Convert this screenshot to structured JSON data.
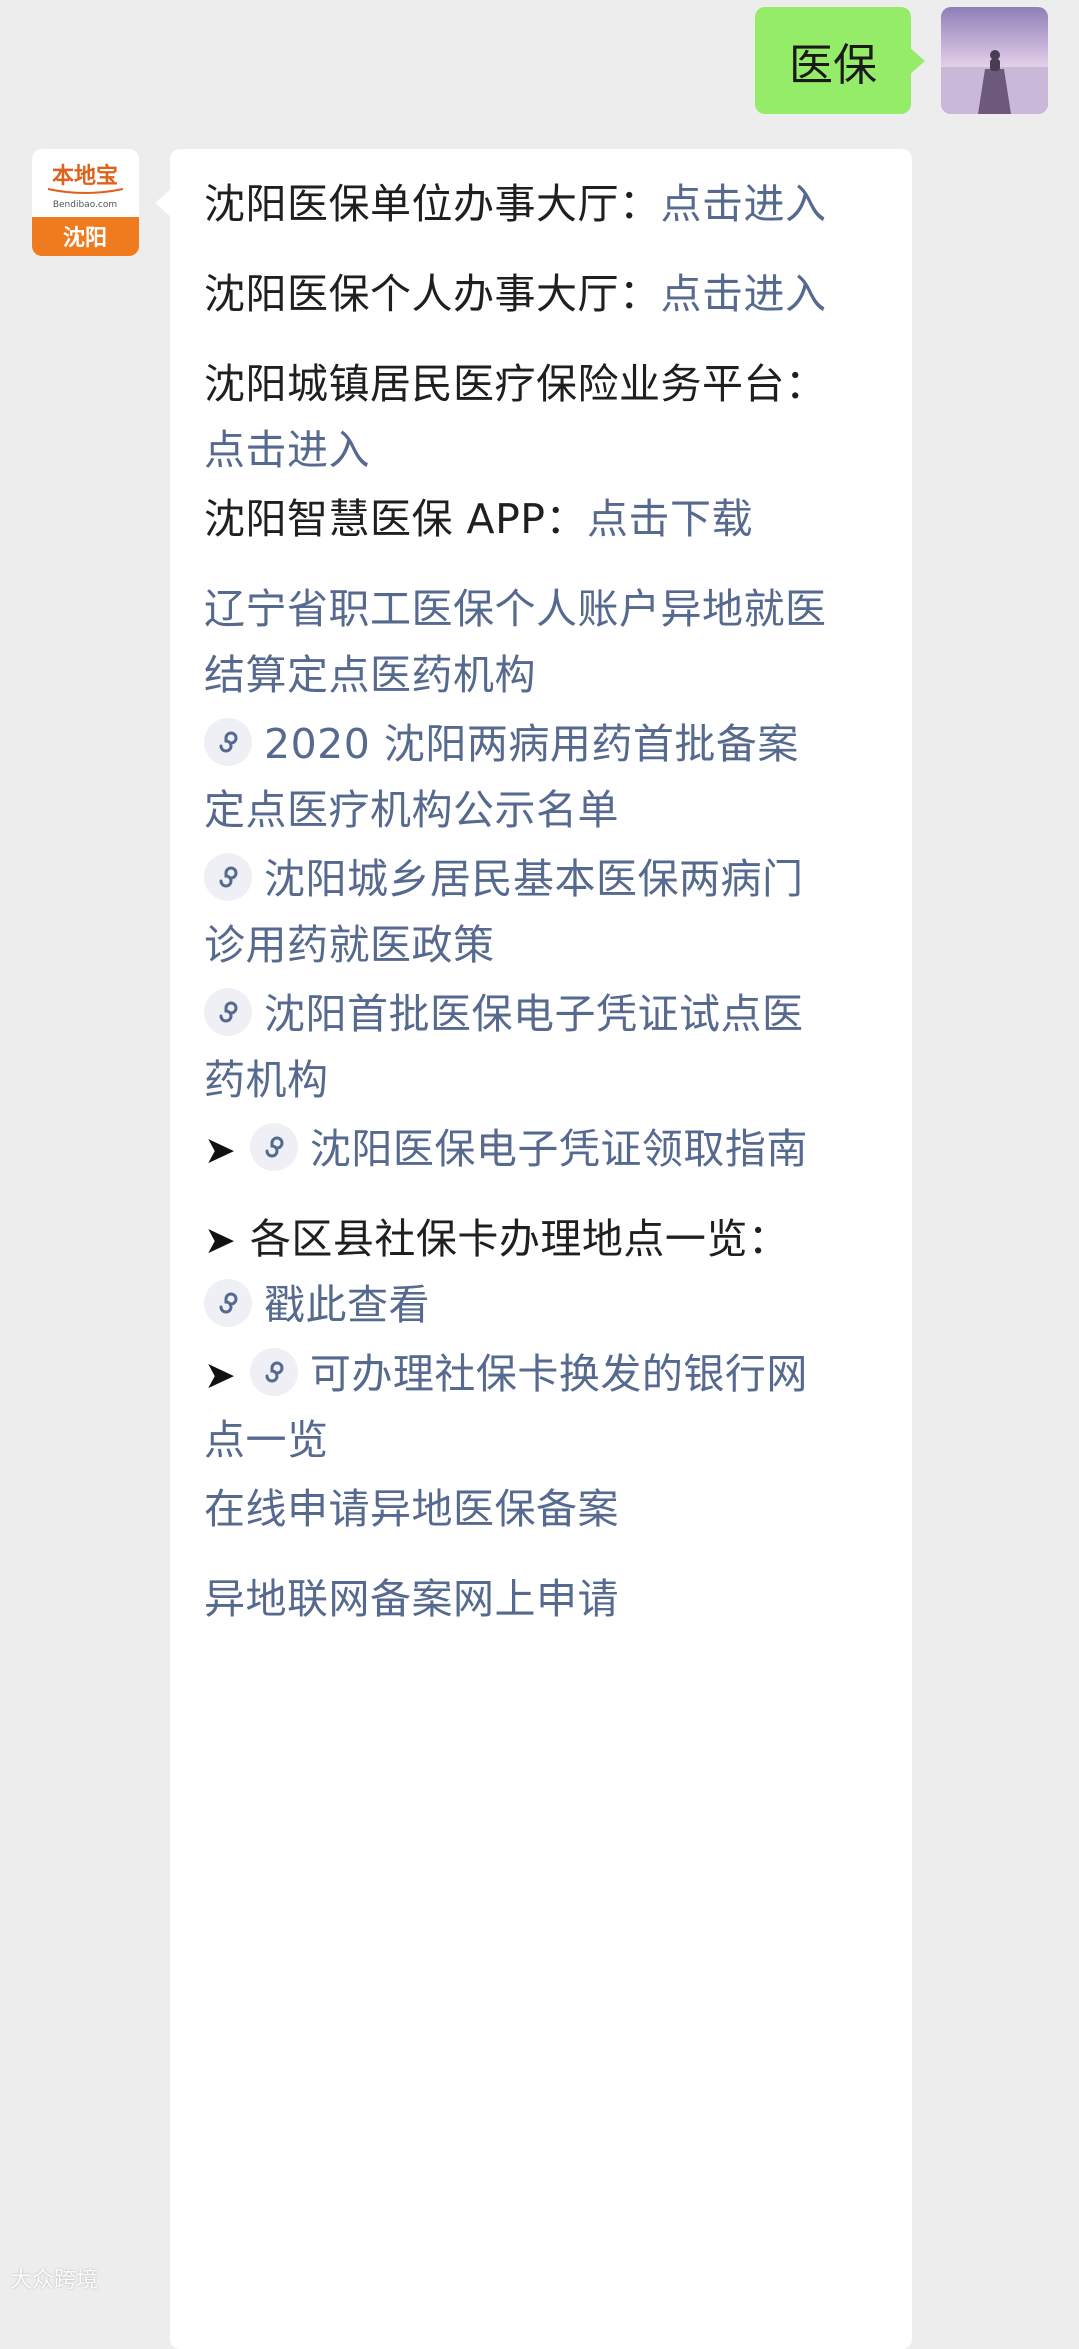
{
  "user_message": {
    "text": "医保"
  },
  "bot_avatar": {
    "brand": "本地宝",
    "domain": "Bendibao.com",
    "city": "沈阳"
  },
  "reply": {
    "l1_title": "沈阳医保单位办事大厅：",
    "l1_link": "点击进入",
    "l2_title": "沈阳医保个人办事大厅：",
    "l2_link": "点击进入",
    "l3_title": "沈阳城镇居民医疗保险业务平台：",
    "l3_link": "点击进入",
    "l4_title": "沈阳智慧医保 APP：",
    "l4_link": "点击下载",
    "l5_line1": "辽宁省职工医保个人账户异地就医",
    "l5_line2": "结算定点医药机构",
    "l6_line1": "2020 沈阳两病用药首批备案",
    "l6_line2": "定点医疗机构公示名单",
    "l7_line1": "沈阳城乡居民基本医保两病门",
    "l7_line2": "诊用药就医政策",
    "l8_line1": "沈阳首批医保电子凭证试点医",
    "l8_line2": "药机构",
    "arrow": "➤",
    "l9": "沈阳医保电子凭证领取指南",
    "l10_title": "各区县社保卡办理地点一览：",
    "l10_link": "戳此查看",
    "l11_line1": "可办理社保卡换发的银行网",
    "l11_line2": "点一览",
    "l12": "在线申请异地医保备案",
    "l13": "异地联网备案网上申请"
  },
  "watermark": "大众跨境",
  "colors": {
    "background": "#ededed",
    "bubble_out": "#95ec69",
    "bubble_in": "#ffffff",
    "link": "#56698f",
    "brand_orange": "#f07b1e"
  },
  "icons": [
    "miniprogram-icon",
    "arrow-icon"
  ]
}
